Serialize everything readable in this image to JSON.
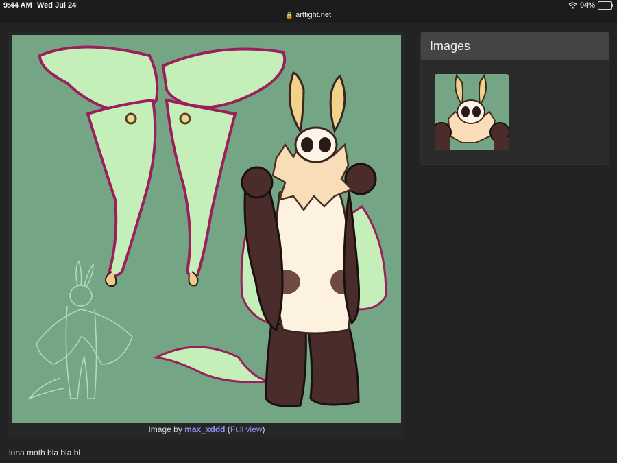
{
  "status": {
    "time": "9:44 AM",
    "date": "Wed Jul 24",
    "battery": "94%",
    "battery_level": 0.94
  },
  "browser": {
    "url": "artfight.net"
  },
  "art": {
    "caption_prefix": "Image by ",
    "artist": "max_xddd",
    "paren_open": " (",
    "full_view": "Full view",
    "paren_close": ")"
  },
  "images_panel": {
    "title": "Images"
  },
  "description": "luna moth bla bla bl",
  "colors": {
    "page_bg": "#232323",
    "art_bg": "#74a585",
    "wing_green": "#c4efb8",
    "wing_edge": "#9a1f5a",
    "fur_brown": "#4a2c2a",
    "body_cream": "#fdf1df",
    "link": "#8f8ff0",
    "battery": "#f5c518"
  }
}
